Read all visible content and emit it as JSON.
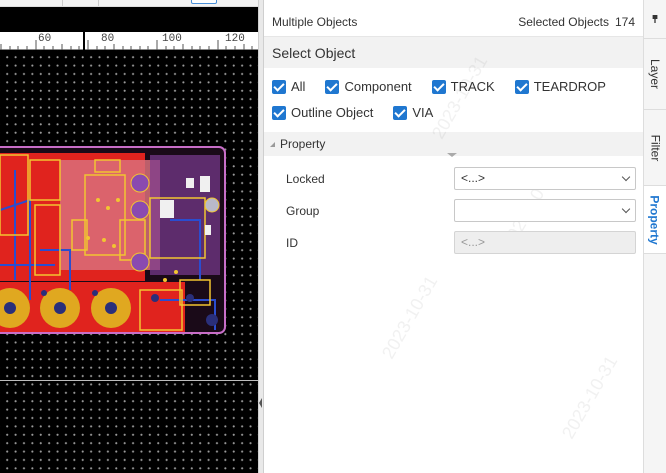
{
  "ruler": {
    "ticks": [
      "60",
      "80",
      "100",
      "120"
    ]
  },
  "panel": {
    "header_title": "Multiple Objects",
    "selected_label": "Selected Objects",
    "selected_count": "174",
    "select_object_title": "Select Object",
    "filters": [
      {
        "label": "All",
        "checked": true
      },
      {
        "label": "Component",
        "checked": true
      },
      {
        "label": "TRACK",
        "checked": true
      },
      {
        "label": "TEARDROP",
        "checked": true
      },
      {
        "label": "Outline Object",
        "checked": true
      },
      {
        "label": "VIA",
        "checked": true
      }
    ],
    "property_section": "Property",
    "properties": [
      {
        "label": "Locked",
        "value": "<...>",
        "disabled": false
      },
      {
        "label": "Group",
        "value": "",
        "disabled": false
      },
      {
        "label": "ID",
        "value": "<...>",
        "disabled": true
      }
    ]
  },
  "side_tabs": [
    {
      "label": "Layer",
      "active": false
    },
    {
      "label": "Filter",
      "active": false
    },
    {
      "label": "Property",
      "active": true
    }
  ],
  "icons": {
    "pin": "pin-icon",
    "checkbox": "checkbox-checked-icon",
    "dropdown": "chevron-down-icon",
    "collapse": "triangle-collapse-icon"
  },
  "colors": {
    "accent": "#1f77d0",
    "board_copper_top": "#e0231e",
    "board_outline": "#c86ec8",
    "canvas_bg": "#000000"
  }
}
